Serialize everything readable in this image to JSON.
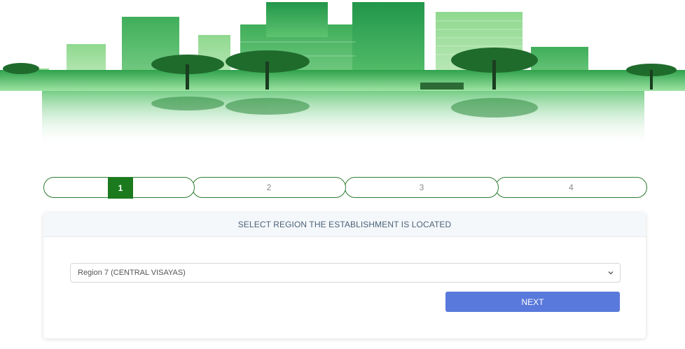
{
  "banner": {
    "image_name": "green-city-skyline-illustration"
  },
  "steps": [
    {
      "label": "1",
      "active": true
    },
    {
      "label": "2",
      "active": false
    },
    {
      "label": "3",
      "active": false
    },
    {
      "label": "4",
      "active": false
    }
  ],
  "card": {
    "header": "SELECT REGION THE ESTABLISHMENT IS LOCATED",
    "region_select": {
      "value": "Region 7 (CENTRAL VISAYAS)",
      "icon": "chevron-down-icon"
    },
    "next_label": "NEXT"
  },
  "colors": {
    "step_border": "#2e7d32",
    "step_active": "#1b7a1e",
    "next_button": "#5a79dc",
    "header_text": "#4a6278"
  }
}
